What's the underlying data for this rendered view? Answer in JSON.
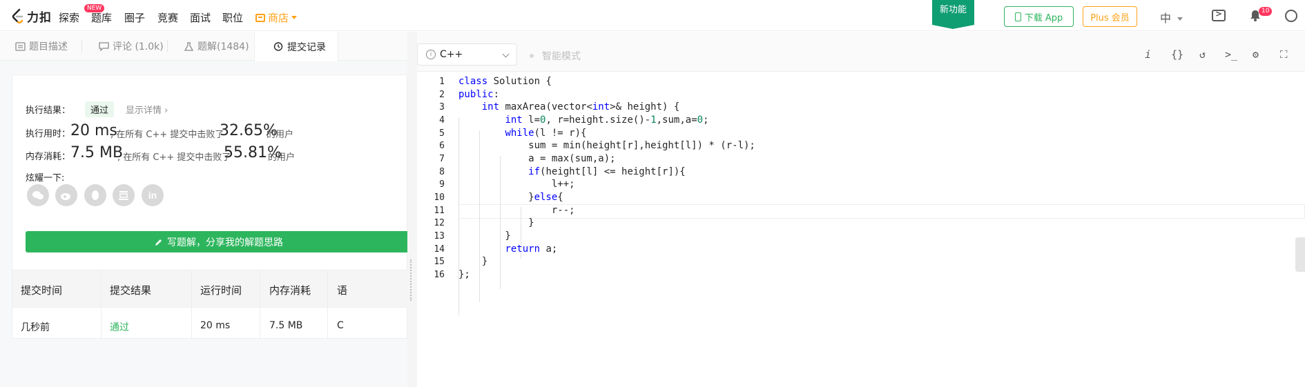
{
  "nav": {
    "logo": "力扣",
    "items": [
      "探索",
      "题库",
      "圈子",
      "竞赛",
      "面试",
      "职位"
    ],
    "new_badge": "NEW",
    "store": "商店",
    "new_feature": "新功能",
    "download_app": "下载 App",
    "plus": "Plus 会员",
    "language": "中",
    "notification_count": "10"
  },
  "tabs": [
    {
      "label": "题目描述",
      "icon": "description-icon"
    },
    {
      "label": "评论 (1.0k)",
      "icon": "comment-icon"
    },
    {
      "label": "题解(1484)",
      "icon": "flask-icon"
    },
    {
      "label": "提交记录",
      "icon": "clock-icon"
    }
  ],
  "result": {
    "label_result": "执行结果：",
    "status": "通过",
    "details": "显示详情",
    "label_time": "执行用时：",
    "time_value": "20 ms",
    "time_text": ", 在所有 C++ 提交中击败了",
    "time_percent": "32.65%",
    "suffix": "的用户",
    "label_mem": "内存消耗：",
    "mem_value": "7.5 MB",
    "mem_text": ", 在所有 C++ 提交中击败了",
    "mem_percent": "55.81%",
    "share_label": "炫耀一下:",
    "share_icons": [
      "wechat-icon",
      "weibo-icon",
      "qq-icon",
      "douban-icon",
      "linkedin-icon"
    ],
    "write_button": "写题解，分享我的解题思路"
  },
  "submissions": {
    "headers": [
      "提交时间",
      "提交结果",
      "运行时间",
      "内存消耗",
      "语"
    ],
    "rows": [
      {
        "time": "几秒前",
        "result": "通过",
        "runtime": "20 ms",
        "memory": "7.5 MB",
        "lang": "C"
      }
    ]
  },
  "editor": {
    "language": "C++",
    "smart_mode": "智能模式",
    "tools": [
      "i",
      "{}",
      "↺",
      ">_",
      "⚙",
      "⛶"
    ],
    "lines": [
      "class Solution {",
      "public:",
      "    int maxArea(vector<int>& height) {",
      "        int l=0, r=height.size()-1,sum,a=0;",
      "        while(l != r){",
      "            sum = min(height[r],height[l]) * (r-l);",
      "            a = max(sum,a);",
      "            if(height[l] <= height[r]){",
      "                l++;",
      "            }else{",
      "                r--;",
      "            }",
      "        }",
      "        return a;",
      "    }",
      "};"
    ],
    "current_line": 11
  },
  "colors": {
    "green": "#2db55d",
    "orange": "#ffa116",
    "keyword": "#0000ff",
    "number": "#098658"
  }
}
